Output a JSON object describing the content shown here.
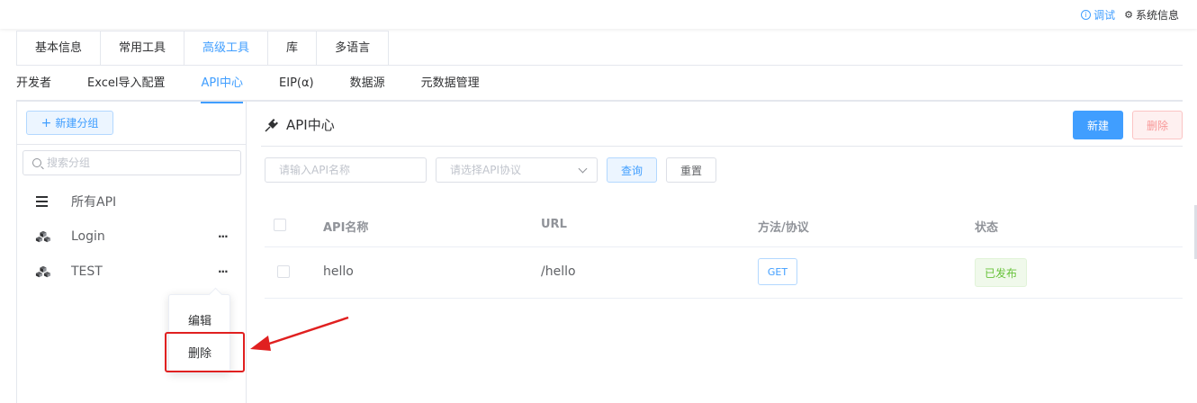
{
  "topbar": {
    "debug_label": "调试",
    "system_label": "系统信息"
  },
  "card_tabs": [
    {
      "label": "基本信息",
      "active": false
    },
    {
      "label": "常用工具",
      "active": false
    },
    {
      "label": "高级工具",
      "active": true
    },
    {
      "label": "库",
      "active": false
    },
    {
      "label": "多语言",
      "active": false
    }
  ],
  "sub_tabs": [
    {
      "label": "开发者",
      "active": false
    },
    {
      "label": "Excel导入配置",
      "active": false
    },
    {
      "label": "API中心",
      "active": true
    },
    {
      "label": "EIP(α)",
      "active": false
    },
    {
      "label": "数据源",
      "active": false
    },
    {
      "label": "元数据管理",
      "active": false
    }
  ],
  "sidebar": {
    "new_group_label": "新建分组",
    "search_placeholder": "搜索分组",
    "groups": [
      {
        "label": "所有API",
        "icon": "list-icon"
      },
      {
        "label": "Login",
        "icon": "cubes-icon",
        "more": "···"
      },
      {
        "label": "TEST",
        "icon": "cubes-icon",
        "more": "···"
      }
    ]
  },
  "dropdown": {
    "items": [
      "编辑",
      "删除"
    ],
    "highlighted": "删除"
  },
  "main": {
    "title": "API中心",
    "new_button": "新建",
    "delete_button": "删除",
    "name_placeholder": "请输入API名称",
    "protocol_placeholder": "请选择API协议",
    "query_button": "查询",
    "reset_button": "重置",
    "table": {
      "headers": [
        "API名称",
        "URL",
        "方法/协议",
        "状态"
      ],
      "rows": [
        {
          "name": "hello",
          "url": "/hello",
          "method": "GET",
          "status": "已发布"
        }
      ]
    }
  },
  "colors": {
    "primary": "#409eff",
    "danger": "#f56c6c",
    "success": "#67c23a",
    "annotation": "#e02020"
  }
}
